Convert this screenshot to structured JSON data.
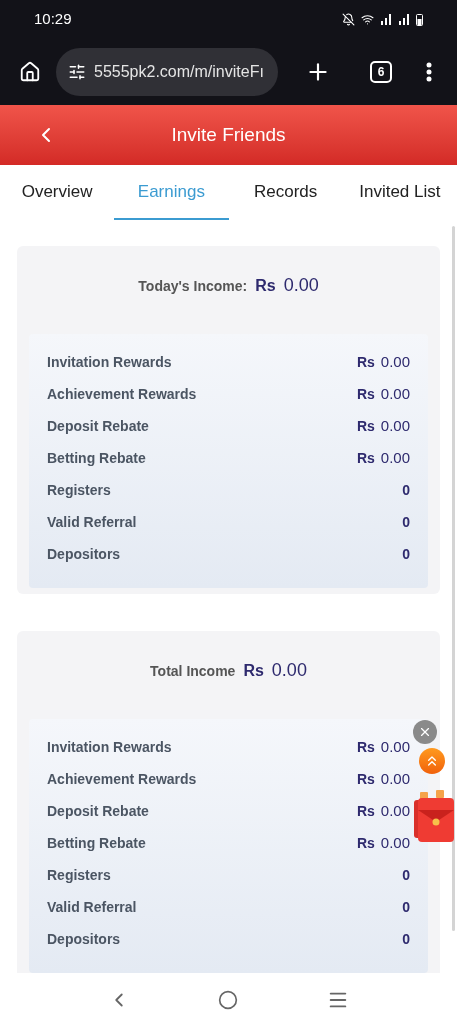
{
  "status_bar": {
    "time": "10:29"
  },
  "browser": {
    "url": "5555pk2.com/m/inviteFı",
    "tab_count": "6"
  },
  "header": {
    "title": "Invite Friends"
  },
  "tabs": [
    {
      "label": "Overview",
      "selected": false
    },
    {
      "label": "Earnings",
      "selected": true
    },
    {
      "label": "Records",
      "selected": false
    },
    {
      "label": "Invited List",
      "selected": false
    }
  ],
  "cards": [
    {
      "title": "Today's Income:",
      "currency": "Rs",
      "amount": "0.00",
      "rows": [
        {
          "label": "Invitation Rewards",
          "kind": "money",
          "currency": "Rs",
          "value": "0.00"
        },
        {
          "label": "Achievement Rewards",
          "kind": "money",
          "currency": "Rs",
          "value": "0.00"
        },
        {
          "label": "Deposit Rebate",
          "kind": "money",
          "currency": "Rs",
          "value": "0.00"
        },
        {
          "label": "Betting Rebate",
          "kind": "money",
          "currency": "Rs",
          "value": "0.00"
        },
        {
          "label": "Registers",
          "kind": "count",
          "value": "0"
        },
        {
          "label": "Valid Referral",
          "kind": "count",
          "value": "0"
        },
        {
          "label": "Depositors",
          "kind": "count",
          "value": "0"
        }
      ]
    },
    {
      "title": "Total Income",
      "currency": "Rs",
      "amount": "0.00",
      "rows": [
        {
          "label": "Invitation Rewards",
          "kind": "money",
          "currency": "Rs",
          "value": "0.00"
        },
        {
          "label": "Achievement Rewards",
          "kind": "money",
          "currency": "Rs",
          "value": "0.00"
        },
        {
          "label": "Deposit Rebate",
          "kind": "money",
          "currency": "Rs",
          "value": "0.00"
        },
        {
          "label": "Betting Rebate",
          "kind": "money",
          "currency": "Rs",
          "value": "0.00"
        },
        {
          "label": "Registers",
          "kind": "count",
          "value": "0"
        },
        {
          "label": "Valid Referral",
          "kind": "count",
          "value": "0"
        },
        {
          "label": "Depositors",
          "kind": "count",
          "value": "0"
        }
      ]
    }
  ]
}
